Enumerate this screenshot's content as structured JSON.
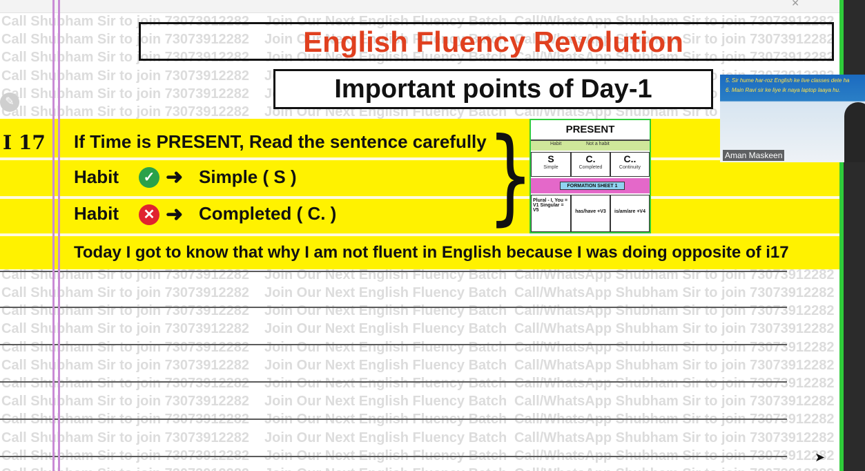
{
  "watermark": {
    "col1": "Call Shubham Sir to join 73073912282",
    "col2": "Join Our Next English Fluency Batch",
    "col3": "Call/WhatsApp Shubham Sir to join 73073912282"
  },
  "title": "English Fluency Revolution",
  "subtitle": "Important points of Day-1",
  "rule": {
    "id": "I 17",
    "line1": "If Time is PRESENT, Read the sentence carefully",
    "habit_label": "Habit",
    "habit_yes_result": "Simple ( S )",
    "habit_no_result": "Completed ( C. )",
    "conclusion": "Today I got to know that why I am not fluent in English because I was doing opposite of i17"
  },
  "chart": {
    "heading": "PRESENT",
    "strip": [
      "Habit",
      "Not a habit"
    ],
    "cells": [
      {
        "big": "S",
        "small": "Simple"
      },
      {
        "big": "C.",
        "small": "Completed"
      },
      {
        "big": "C..",
        "small": "Continuity"
      }
    ],
    "formation": "FORMATION SHEET 1",
    "bottom": [
      "Plural - I, You = V1 Singular = V5",
      "has/have +V3",
      "is/am/are +V4"
    ]
  },
  "webcam": {
    "line1": "5. Sir hume har-roz English ke live classes dete ha",
    "line2": "6. Main Ravi sir ke liye ik naya laptop laaya hu.",
    "name": "Aman Maskeen"
  },
  "icons": {
    "check": "check-circle-icon",
    "cross": "cross-circle-icon",
    "arrow": "right-arrow-icon",
    "brace": "right-brace-icon",
    "pen": "pen-icon",
    "cursor": "mouse-cursor-icon"
  },
  "colors": {
    "title": "#e0401f",
    "highlight": "#fff200",
    "border_green": "#2fcc3a",
    "check": "#2aa14a",
    "cross": "#e0232f"
  }
}
